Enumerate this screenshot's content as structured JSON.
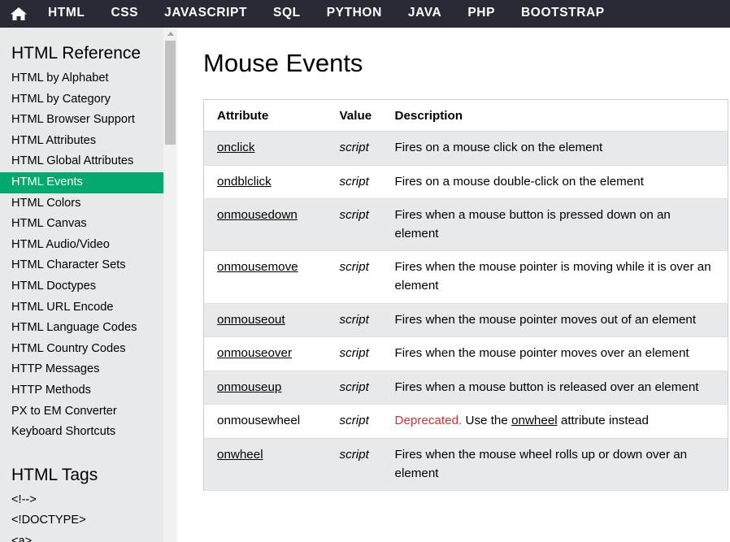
{
  "nav": {
    "home_icon": "home-icon",
    "links": [
      "HTML",
      "CSS",
      "JAVASCRIPT",
      "SQL",
      "PYTHON",
      "JAVA",
      "PHP",
      "BOOTSTRAP"
    ]
  },
  "sidebar": {
    "heading1": "HTML Reference",
    "items": [
      "HTML by Alphabet",
      "HTML by Category",
      "HTML Browser Support",
      "HTML Attributes",
      "HTML Global Attributes",
      "HTML Events",
      "HTML Colors",
      "HTML Canvas",
      "HTML Audio/Video",
      "HTML Character Sets",
      "HTML Doctypes",
      "HTML URL Encode",
      "HTML Language Codes",
      "HTML Country Codes",
      "HTTP Messages",
      "HTTP Methods",
      "PX to EM Converter",
      "Keyboard Shortcuts"
    ],
    "active_index": 5,
    "heading2": "HTML Tags",
    "tags": [
      "<!-->",
      "<!DOCTYPE>",
      "<a>"
    ]
  },
  "main": {
    "title": "Mouse Events",
    "table": {
      "headers": [
        "Attribute",
        "Value",
        "Description"
      ],
      "rows": [
        {
          "attr": "onclick",
          "value": "script",
          "desc": "Fires on a mouse click on the element"
        },
        {
          "attr": "ondblclick",
          "value": "script",
          "desc": "Fires on a mouse double-click on the element"
        },
        {
          "attr": "onmousedown",
          "value": "script",
          "desc": "Fires when a mouse button is pressed down on an element"
        },
        {
          "attr": "onmousemove",
          "value": "script",
          "desc": "Fires when the mouse pointer is moving while it is over an element"
        },
        {
          "attr": "onmouseout",
          "value": "script",
          "desc": "Fires when the mouse pointer moves out of an element"
        },
        {
          "attr": "onmouseover",
          "value": "script",
          "desc": "Fires when the mouse pointer moves over an element"
        },
        {
          "attr": "onmouseup",
          "value": "script",
          "desc": "Fires when a mouse button is released over an element"
        },
        {
          "attr": "onmousewheel",
          "value": "script",
          "deprecated": "Deprecated.",
          "desc_pre": "Use the",
          "desc_link": "onwheel",
          "desc_post": "attribute instead"
        },
        {
          "attr": "onwheel",
          "value": "script",
          "desc": "Fires when the mouse wheel rolls up or down over an element"
        }
      ]
    }
  },
  "colors": {
    "nav_bg": "#282a35",
    "active_item": "#04aa6d",
    "deprecated": "#d32f2f",
    "sidebar_bg": "#e7e9eb"
  }
}
